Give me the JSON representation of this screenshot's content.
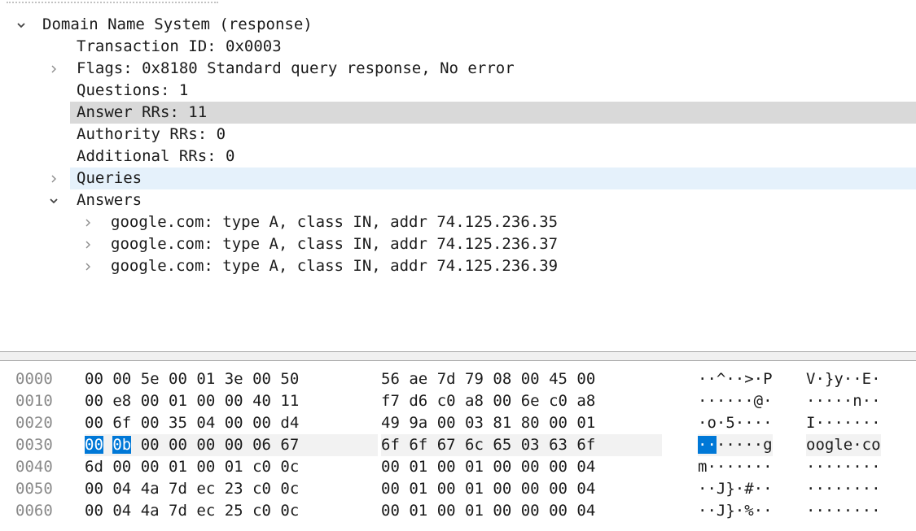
{
  "details": {
    "rows": [
      {
        "label": "Domain Name System (response)",
        "expander": "expanded",
        "state": "normal"
      },
      {
        "label": "Transaction ID: 0x0003",
        "expander": "none",
        "state": "normal"
      },
      {
        "label": "Flags: 0x8180 Standard query response, No error",
        "expander": "collapsed",
        "state": "normal"
      },
      {
        "label": "Questions: 1",
        "expander": "none",
        "state": "normal"
      },
      {
        "label": "Answer RRs: 11",
        "expander": "none",
        "state": "selected"
      },
      {
        "label": "Authority RRs: 0",
        "expander": "none",
        "state": "normal"
      },
      {
        "label": "Additional RRs: 0",
        "expander": "none",
        "state": "normal"
      },
      {
        "label": "Queries",
        "expander": "collapsed",
        "state": "hover"
      },
      {
        "label": "Answers",
        "expander": "expanded",
        "state": "normal"
      },
      {
        "label": "google.com: type A, class IN, addr 74.125.236.35",
        "expander": "collapsed",
        "state": "normal"
      },
      {
        "label": "google.com: type A, class IN, addr 74.125.236.37",
        "expander": "collapsed",
        "state": "normal"
      },
      {
        "label": "google.com: type A, class IN, addr 74.125.236.39",
        "expander": "collapsed",
        "state": "normal"
      }
    ]
  },
  "hex": {
    "rows": [
      {
        "offset": "0000",
        "bytes_a": [
          "00",
          "00",
          "5e",
          "00",
          "01",
          "3e",
          "00",
          "50"
        ],
        "bytes_b": [
          "56",
          "ae",
          "7d",
          "79",
          "08",
          "00",
          "45",
          "00"
        ],
        "ascii_a": "··^··>·P",
        "ascii_b": "V·}y··E·"
      },
      {
        "offset": "0010",
        "bytes_a": [
          "00",
          "e8",
          "00",
          "01",
          "00",
          "00",
          "40",
          "11"
        ],
        "bytes_b": [
          "f7",
          "d6",
          "c0",
          "a8",
          "00",
          "6e",
          "c0",
          "a8"
        ],
        "ascii_a": "······@·",
        "ascii_b": "·····n··"
      },
      {
        "offset": "0020",
        "bytes_a": [
          "00",
          "6f",
          "00",
          "35",
          "04",
          "00",
          "00",
          "d4"
        ],
        "bytes_b": [
          "49",
          "9a",
          "00",
          "03",
          "81",
          "80",
          "00",
          "01"
        ],
        "ascii_a": "·o·5····",
        "ascii_b": "I·······"
      },
      {
        "offset": "0030",
        "bytes_a": [
          "00",
          "0b",
          "00",
          "00",
          "00",
          "00",
          "06",
          "67"
        ],
        "bytes_b": [
          "6f",
          "6f",
          "67",
          "6c",
          "65",
          "03",
          "63",
          "6f"
        ],
        "ascii_a": "·······g",
        "ascii_b": "oogle·co",
        "highlight_bytes": 2,
        "highlight_ascii": 2
      },
      {
        "offset": "0040",
        "bytes_a": [
          "6d",
          "00",
          "00",
          "01",
          "00",
          "01",
          "c0",
          "0c"
        ],
        "bytes_b": [
          "00",
          "01",
          "00",
          "01",
          "00",
          "00",
          "00",
          "04"
        ],
        "ascii_a": "m·······",
        "ascii_b": "········"
      },
      {
        "offset": "0050",
        "bytes_a": [
          "00",
          "04",
          "4a",
          "7d",
          "ec",
          "23",
          "c0",
          "0c"
        ],
        "bytes_b": [
          "00",
          "01",
          "00",
          "01",
          "00",
          "00",
          "00",
          "04"
        ],
        "ascii_a": "··J}·#··",
        "ascii_b": "········"
      },
      {
        "offset": "0060",
        "bytes_a": [
          "00",
          "04",
          "4a",
          "7d",
          "ec",
          "25",
          "c0",
          "0c"
        ],
        "bytes_b": [
          "00",
          "01",
          "00",
          "01",
          "00",
          "00",
          "00",
          "04"
        ],
        "ascii_a": "··J}·%··",
        "ascii_b": "········"
      }
    ]
  },
  "colors": {
    "selected_row": "#d9d9d9",
    "hover_row": "#e5f1fb",
    "byte_highlight": "#0078d7"
  }
}
